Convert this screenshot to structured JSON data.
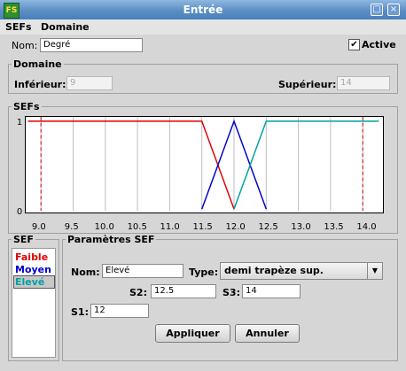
{
  "window": {
    "title": "Entrée",
    "app_icon": "FS"
  },
  "menu": [
    "SEFs",
    "Domaine"
  ],
  "header": {
    "nom_label": "Nom:",
    "nom_value": "Degré",
    "active_label": "Active",
    "active_checked": true
  },
  "domaine": {
    "title": "Domaine",
    "inferieur_label": "Inférieur:",
    "inferieur_value": "9",
    "superieur_label": "Supérieur:",
    "superieur_value": "14"
  },
  "sefs": {
    "title": "SEFs"
  },
  "chart_data": {
    "type": "line",
    "xlim": [
      8.8,
      14.25
    ],
    "ylim": [
      0,
      1
    ],
    "x_ticks": [
      9.0,
      9.5,
      10.0,
      10.5,
      11.0,
      11.5,
      12.0,
      12.5,
      13.0,
      13.5,
      14.0
    ],
    "x_tick_labels": [
      "9.0",
      "9.5",
      "10.0",
      "10.5",
      "11.0",
      "11.5",
      "12.0",
      "12.5",
      "13.0",
      "13.5",
      "14.0"
    ],
    "y_tick_labels": [
      "1",
      "0"
    ],
    "domain_markers": [
      9.0,
      14.0
    ],
    "series": [
      {
        "name": "Faible",
        "color": "#e00000",
        "x": [
          8.8,
          11.5,
          12.0
        ],
        "y": [
          1,
          1,
          0
        ]
      },
      {
        "name": "Moyen",
        "color": "#0000cc",
        "x": [
          11.5,
          12.0,
          12.5
        ],
        "y": [
          0,
          1,
          0
        ]
      },
      {
        "name": "Elevé",
        "color": "#00a0a0",
        "x": [
          12.0,
          12.5,
          14.25
        ],
        "y": [
          0,
          1,
          1
        ]
      }
    ]
  },
  "sef_list": {
    "title": "SEF",
    "items": [
      {
        "label": "Faible",
        "color": "#e00000",
        "selected": false
      },
      {
        "label": "Moyen",
        "color": "#0000cc",
        "selected": false
      },
      {
        "label": "Elevé",
        "color": "#00a0a0",
        "selected": true
      }
    ]
  },
  "params": {
    "title": "Paramètres SEF",
    "nom_label": "Nom:",
    "nom_value": "Elevé",
    "type_label": "Type:",
    "type_value": "demi trapèze sup.",
    "s2_label": "S2:",
    "s2_value": "12.5",
    "s3_label": "S3:",
    "s3_value": "14",
    "s1_label": "S1:",
    "s1_value": "12",
    "apply_label": "Appliquer",
    "cancel_label": "Annuler"
  }
}
